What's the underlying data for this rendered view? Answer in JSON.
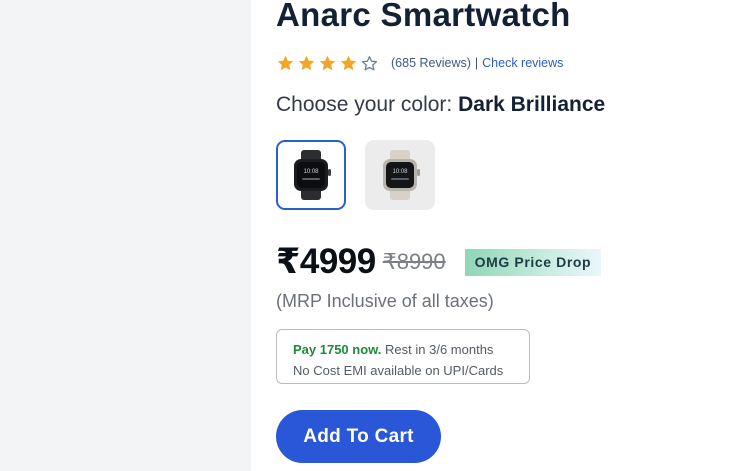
{
  "product": {
    "title": "Anarc Smartwatch",
    "rating": {
      "stars": 4,
      "max_stars": 5,
      "reviews_text": "(685 Reviews)",
      "separator": "|",
      "check_reviews_label": "Check reviews"
    },
    "color": {
      "label": "Choose your color:",
      "selected": "Dark Brilliance",
      "options": [
        {
          "name": "Dark Brilliance",
          "icon": "smartwatch-black-icon",
          "selected": true
        },
        {
          "name": "Silver",
          "icon": "smartwatch-silver-icon",
          "selected": false
        }
      ]
    },
    "price": {
      "current": "₹4999",
      "mrp": "₹8990",
      "badge": "OMG Price Drop",
      "tax_note": "(MRP Inclusive of all taxes)"
    },
    "emi": {
      "pay_now": "Pay 1750 now.",
      "rest": "Rest in 3/6 months",
      "line2": "No Cost EMI available on UPI/Cards"
    },
    "add_to_cart_label": "Add To Cart"
  },
  "colors": {
    "star": "#f5a524",
    "accent": "#2a56d8",
    "selected_border": "#2563c9",
    "emi_green": "#1e8a3a",
    "link": "#2f5fb3"
  }
}
